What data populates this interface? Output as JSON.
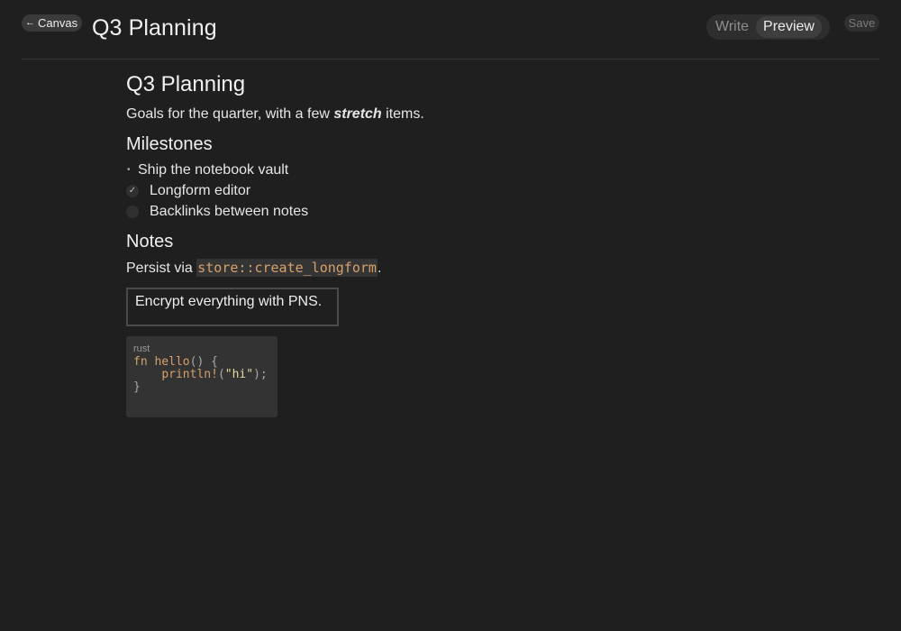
{
  "toolbar": {
    "back_label": "Canvas",
    "back_icon": "arrow-left-icon",
    "title": "Q3 Planning",
    "modes": [
      {
        "label": "Write",
        "active": false
      },
      {
        "label": "Preview",
        "active": true
      }
    ],
    "save_label": "Save"
  },
  "document": {
    "heading": "Q3 Planning",
    "intro_before": "Goals for the quarter, with a few ",
    "intro_emphasis": "stretch",
    "intro_after": " items.",
    "milestones_heading": "Milestones",
    "milestones": [
      {
        "type": "bullet",
        "text": "Ship the notebook vault"
      },
      {
        "type": "task",
        "checked": true,
        "text": "Longform editor"
      },
      {
        "type": "task",
        "checked": false,
        "text": "Backlinks between notes"
      }
    ],
    "notes_heading": "Notes",
    "persist_before": "Persist via ",
    "persist_code": "store::create_longform",
    "persist_after": ".",
    "blockquote": "Encrypt everything with PNS.",
    "code": {
      "language": "rust",
      "line1_kw": "fn",
      "line1_fn": "hello",
      "line1_rest": "() {",
      "line2_macro": "println!",
      "line2_open": "(",
      "line2_str": "\"hi\"",
      "line2_close": ");",
      "line3": "}"
    }
  },
  "colors": {
    "background": "#1f1f1f",
    "accent_code": "#d7a16a"
  }
}
